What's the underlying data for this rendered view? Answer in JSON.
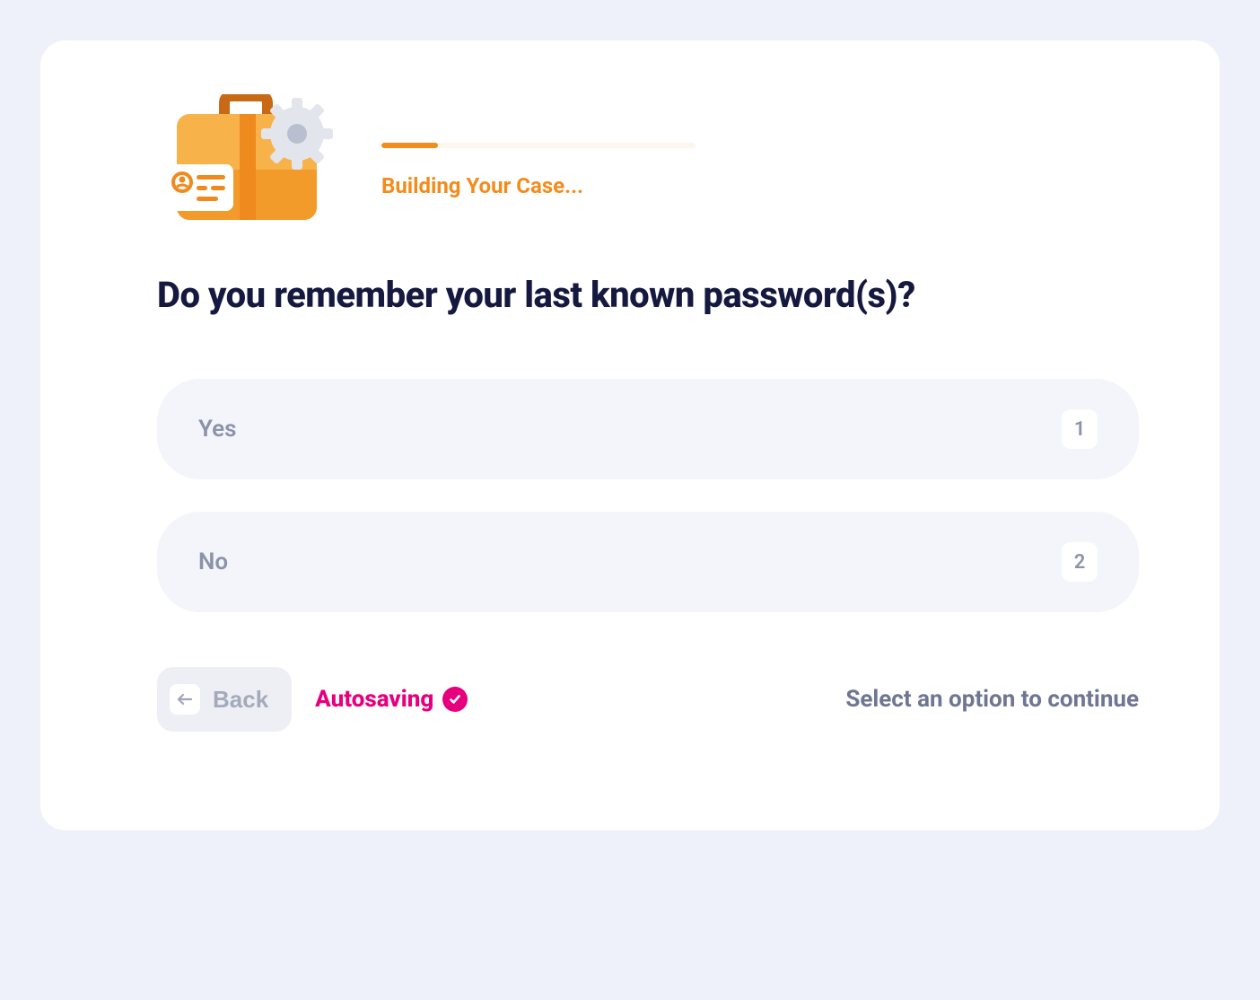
{
  "progress": {
    "label": "Building Your Case...",
    "percent": 18
  },
  "question": "Do you remember your last known password(s)?",
  "options": [
    {
      "label": "Yes",
      "key": "1"
    },
    {
      "label": "No",
      "key": "2"
    }
  ],
  "footer": {
    "back_label": "Back",
    "autosave_label": "Autosaving",
    "hint": "Select an option to continue"
  }
}
